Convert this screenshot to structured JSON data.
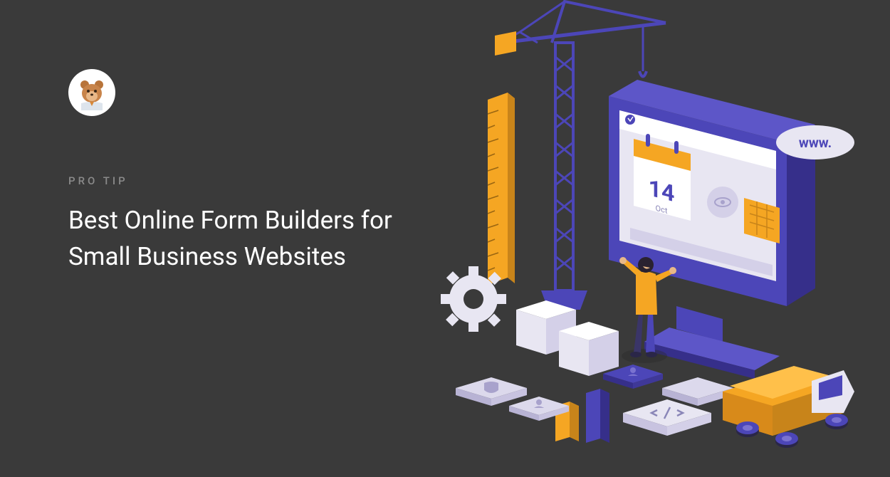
{
  "eyebrow": "PRO TIP",
  "headline": "Best Online Form Builders for Small Business Websites",
  "illustration": {
    "date_number": "14",
    "date_month": "Oct",
    "www_label": "www."
  },
  "colors": {
    "bg": "#3a3a3a",
    "purple": "#4c46b8",
    "orange": "#f5a623",
    "white": "#ffffff",
    "light": "#e8e6f2"
  }
}
